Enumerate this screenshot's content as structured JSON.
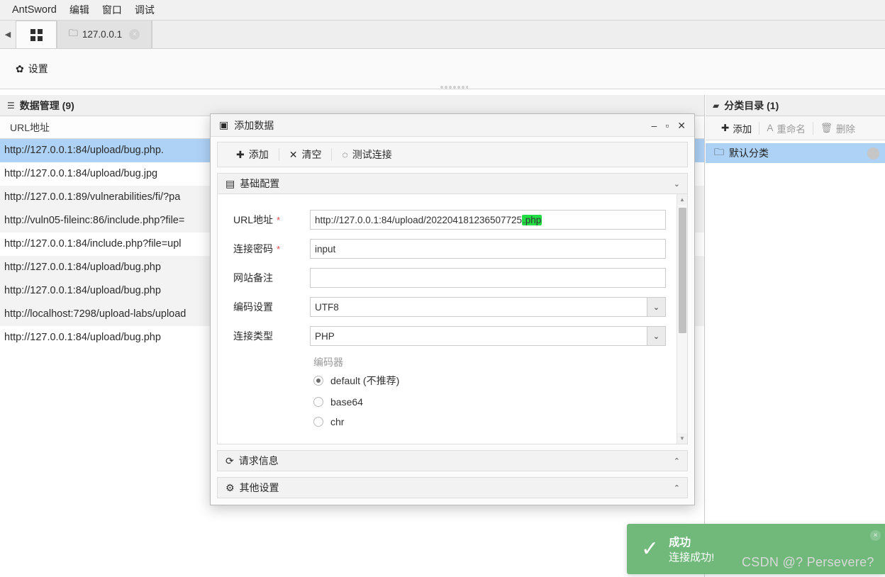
{
  "menubar": {
    "items": [
      {
        "label": "AntSword"
      },
      {
        "label": "编辑"
      },
      {
        "label": "窗口"
      },
      {
        "label": "调试"
      }
    ]
  },
  "tabbar": {
    "back_arrow": "◀",
    "grid_tab_name": "grid-tab",
    "tabs": [
      {
        "label": "127.0.0.1",
        "folder_icon": "🗀",
        "close": "×"
      }
    ]
  },
  "settingsbar": {
    "gear_icon": "✿",
    "settings_label": "设置"
  },
  "left_panel": {
    "header_icon": "☰",
    "header_title": "数据管理 (9)",
    "column_header": "URL地址",
    "rows": [
      {
        "url": "http://127.0.0.1:84/upload/bug.php."
      },
      {
        "url": "http://127.0.0.1:84/upload/bug.jpg"
      },
      {
        "url": "http://127.0.0.1:89/vulnerabilities/fi/?pa"
      },
      {
        "url": "http://vuln05-fileinc:86/include.php?file="
      },
      {
        "url": "http://127.0.0.1:84/include.php?file=upl"
      },
      {
        "url": "http://127.0.0.1:84/upload/bug.php"
      },
      {
        "url": "http://127.0.0.1:84/upload/bug.php"
      },
      {
        "url": "http://localhost:7298/upload-labs/upload"
      },
      {
        "url": "http://127.0.0.1:84/upload/bug.php"
      }
    ]
  },
  "right_panel": {
    "header_icon": "▰",
    "header_title": "分类目录 (1)",
    "toolbar": [
      {
        "icon": "✚",
        "label": "添加",
        "disabled": false
      },
      {
        "icon": "A",
        "label": "重命名",
        "disabled": true
      },
      {
        "icon": "🗑",
        "label": "删除",
        "disabled": true
      }
    ],
    "categories": [
      {
        "icon": "🗀",
        "label": "默认分类"
      }
    ]
  },
  "dialog": {
    "title": "添加数据",
    "title_icon": "▣",
    "controls": {
      "minimize": "–",
      "maximize": "▫",
      "close": "✕"
    },
    "toolbar": [
      {
        "icon": "✚",
        "label": "添加"
      },
      {
        "icon": "✕",
        "label": "清空"
      },
      {
        "icon": "◌",
        "label": "测试连接"
      }
    ],
    "sections": {
      "basic": {
        "icon": "▤",
        "title": "基础配置",
        "chevron": "⌄"
      },
      "request": {
        "icon": "⟳",
        "title": "请求信息",
        "chevron": "⌃"
      },
      "other": {
        "icon": "⚙",
        "title": "其他设置",
        "chevron": "⌃"
      }
    },
    "fields": {
      "url": {
        "label": "URL地址",
        "required": "*",
        "value_plain": "http://127.0.0.1:84/upload/202204181236507725",
        "value_highlight": ".php",
        "value_full": "http://127.0.0.1:84/upload/202204181236507725.php"
      },
      "password": {
        "label": "连接密码",
        "required": "*",
        "value": "input"
      },
      "remark": {
        "label": "网站备注",
        "value": ""
      },
      "encoding": {
        "label": "编码设置",
        "value": "UTF8",
        "arrow": "⌄"
      },
      "conn_type": {
        "label": "连接类型",
        "value": "PHP",
        "arrow": "⌄"
      }
    },
    "encoder": {
      "label": "编码器",
      "options": [
        {
          "label": "default (不推荐)",
          "selected": true
        },
        {
          "label": "base64",
          "selected": false
        },
        {
          "label": "chr",
          "selected": false
        }
      ]
    }
  },
  "toast": {
    "check_icon": "✓",
    "title": "成功",
    "message": "连接成功!",
    "close": "×",
    "accent_color": "#71b97b"
  },
  "watermark": {
    "text": "CSDN @? Persevere?"
  }
}
